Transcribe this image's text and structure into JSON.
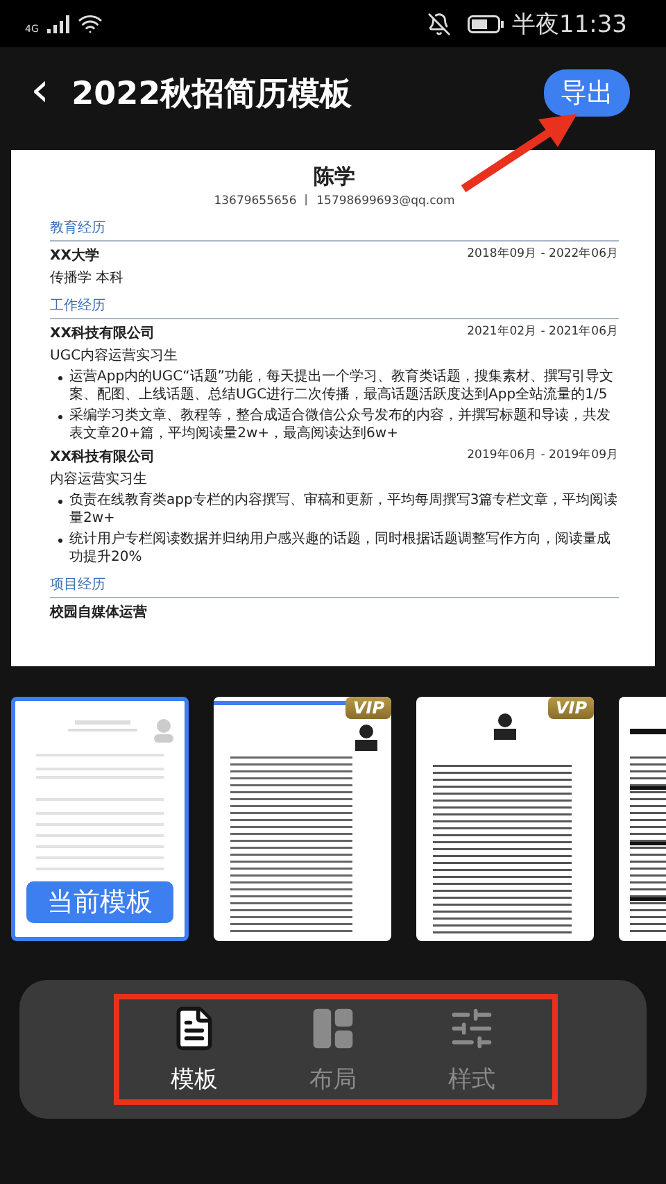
{
  "status_bar": {
    "network": "4G",
    "time": "半夜11:33"
  },
  "header": {
    "back": "‹",
    "title": "2022秋招简历模板",
    "export_button": "导出"
  },
  "resume": {
    "name": "陈学",
    "contact": "13679655656 丨 15798699693@qq.com",
    "sections": [
      {
        "heading": "教育经历",
        "entries": [
          {
            "org": "XX大学",
            "period": "2018年09月 - 2022年06月",
            "role": "传播学 本科"
          }
        ]
      },
      {
        "heading": "工作经历",
        "entries": [
          {
            "org": "XX科技有限公司",
            "period": "2021年02月 - 2021年06月",
            "role": "UGC内容运营实习生",
            "bullets": [
              "运营App内的UGC“话题”功能，每天提出一个学习、教育类话题，搜集素材、撰写引导文案、配图、上线话题、总结UGC进行二次传播，最高话题活跃度达到App全站流量的1/5",
              "采编学习类文章、教程等，整合成适合微信公众号发布的内容，并撰写标题和导读，共发表文章20+篇，平均阅读量2w+，最高阅读达到6w+"
            ]
          },
          {
            "org": "XX科技有限公司",
            "period": "2019年06月 - 2019年09月",
            "role": "内容运营实习生",
            "bullets": [
              "负责在线教育类app专栏的内容撰写、审稿和更新，平均每周撰写3篇专栏文章，平均阅读量2w+",
              "统计用户专栏阅读数据并归纳用户感兴趣的话题，同时根据话题调整写作方向，阅读量成功提升20%"
            ]
          }
        ]
      },
      {
        "heading": "项目经历",
        "entries": [
          {
            "org": "校园自媒体运营"
          }
        ]
      }
    ]
  },
  "templates": [
    {
      "kind": "skeleton",
      "selected": true,
      "vip": false,
      "label": "当前模板"
    },
    {
      "kind": "side-photo",
      "selected": false,
      "vip": true,
      "badge": "VIP"
    },
    {
      "kind": "center-photo",
      "selected": false,
      "vip": true,
      "badge": "VIP"
    },
    {
      "kind": "dark-headings",
      "selected": false,
      "vip": false
    }
  ],
  "tabs": [
    {
      "label": "模板",
      "selected": true
    },
    {
      "label": "布局",
      "selected": false
    },
    {
      "label": "样式",
      "selected": false
    }
  ]
}
